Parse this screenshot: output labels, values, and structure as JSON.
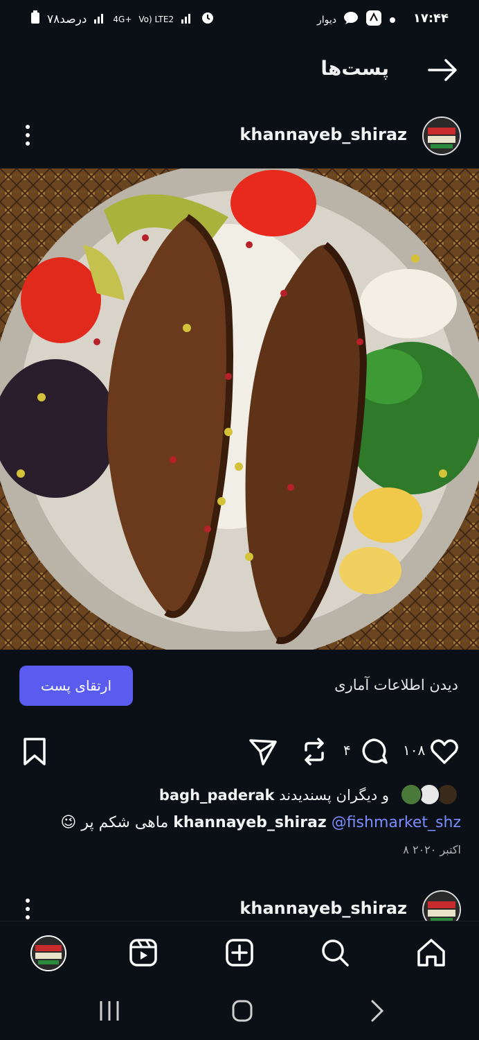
{
  "status_bar": {
    "time": "۱۷:۴۴",
    "app_label": "دیوار",
    "battery": "۷۸درصد",
    "network": "4G+",
    "volte": "Vo) LTE2"
  },
  "header": {
    "title": "پست‌ها"
  },
  "post": {
    "username": "khannayeb_shiraz",
    "boost_label": "ارتقای پست",
    "insights_label": "دیدن اطلاعات آماری",
    "likes_count": "۱۰۸",
    "comments_count": "۴",
    "liked_by_user": "bagh_paderak",
    "liked_by_suffix": "و دیگران پسندیدند",
    "caption_user": "khannayeb_shiraz",
    "caption_mention": "@fishmarket_shz",
    "caption_text": "ماهی شکم پر",
    "caption_emoji": "😉",
    "date": "۸ اکتبر ۲۰۲۰"
  },
  "next_post": {
    "username": "khannayeb_shiraz"
  },
  "colors": {
    "background": "#0b0f16",
    "accent": "#5a5cf0",
    "mention": "#7b8cff"
  }
}
